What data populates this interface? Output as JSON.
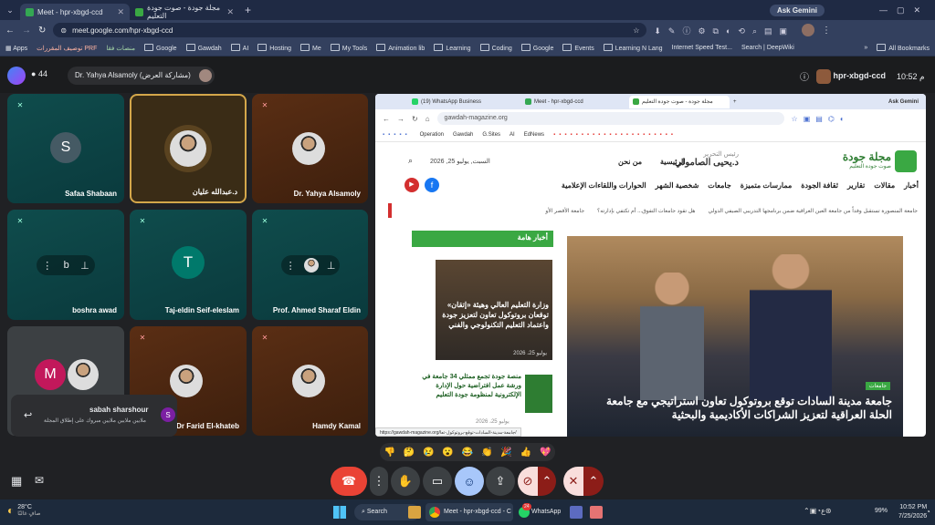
{
  "tabs": [
    {
      "title": "Meet - hpr-xbgd-ccd",
      "active": true
    },
    {
      "title": "مجلة جودة - صوت جودة التعليم",
      "active": false
    }
  ],
  "ask_gemini": "Ask Gemini",
  "url": "meet.google.com/hpr-xbgd-ccd",
  "bookmarks": [
    "Apps",
    "توصيف المقررات PRF",
    "منصات فقا",
    "Google",
    "Gawdah",
    "AI",
    "Hosting",
    "Me",
    "My Tools",
    "Animation lib",
    "Learning",
    "Coding",
    "Google",
    "Events",
    "Learning N Lang",
    "Internet Speed Test...",
    "Search | DeepWiki"
  ],
  "all_bookmarks": "All Bookmarks",
  "meet": {
    "participant_count": "44",
    "presenter_chip": "Dr. Yahya Alsamoly (مشاركة العرض)",
    "time": "10:52 م",
    "meeting_code": "hpr-xbgd-ccd"
  },
  "tiles": [
    {
      "name": "Safaa Shabaan",
      "initial": "S",
      "color": "#455a64"
    },
    {
      "name": "د.عبدالله عليان",
      "initial": "",
      "color": ""
    },
    {
      "name": "Dr. Yahya Alsamoly",
      "initial": "",
      "color": ""
    },
    {
      "name": "boshra awad",
      "initial": "b",
      "color": ""
    },
    {
      "name": "Taj-eldin Seif-eleslam",
      "initial": "T",
      "color": "#00796b"
    },
    {
      "name": "Prof. Ahmed Sharaf Eldin",
      "initial": "",
      "color": ""
    },
    {
      "name": "",
      "initial": "M",
      "color": "#c2185b"
    },
    {
      "name": "Dr Farid El-khateb",
      "initial": "",
      "color": ""
    },
    {
      "name": "Hamdy Kamal",
      "initial": "",
      "color": ""
    }
  ],
  "toast": {
    "name": "sabah sharshour",
    "initial": "S",
    "message": "ملايين ملايين ملايين مبروك على إطلاق المجلة"
  },
  "emojis": [
    "👎",
    "🤔",
    "😢",
    "😮",
    "😂",
    "👏",
    "🎉",
    "👍",
    "💖"
  ],
  "site": {
    "tabs": [
      "(19) WhatsApp Business",
      "Meet - hpr-xbgd-ccd",
      "مجلة جودة - صوت جودة التعليم"
    ],
    "ask_gemini": "Ask Gemini",
    "url": "gawdah-magazine.org",
    "bookmarks": [
      "Operation",
      "Gawdah",
      "G.Sites",
      "AI",
      "EdNews"
    ],
    "logo_title": "مجلة جودة",
    "logo_sub": "صوت جودة التعليم",
    "editor_label": "رئيس التحرير",
    "editor_name": "د.يحيى الصامولي",
    "date": "السبت, يوليو 25, 2026",
    "nav_top": [
      "الرئيسية",
      "من نحن"
    ],
    "nav": [
      "أخبار",
      "مقالات",
      "تقارير",
      "ثقافة الجودة",
      "ممارسات متميزة",
      "جامعات",
      "شخصية الشهر",
      "الحوارات واللقاءات الإعلامية"
    ],
    "ticker": [
      "جامعة المنصورة تستقبل وفداً من جامعة العين العراقية ضمن برنامجها التدريبي الصيفي الدولي",
      "هل تقود جامعات التفوق... أم تكتفي بإدارته؟",
      "جامعة الأقصر الأو"
    ],
    "side_header": "أخبار هامة",
    "side_story1": "وزارة التعليم العالي وهيئة «إتقان» توقعان بروتوكول تعاون لتعزيز جودة واعتماد التعليم التكنولوجي والفني",
    "side_date1": "يوليو 25، 2026",
    "side_story2": "منصة جودة تجمع ممثلي 34 جامعة في ورشة عمل افتراضية حول الإدارة الإلكترونية لمنظومة جودة التعليم",
    "side_date2": "يوليو 25، 2026",
    "hero_badge": "جامعات",
    "hero_title": "جامعة مدينة السادات توقع بروتوكول تعاون استراتيجي مع جامعة الحلة العراقية لتعزيز الشراكات الأكاديمية والبحثية",
    "status_url": "https://gawdah-magazine.org/جامعة-مدينة-السادات-توقع-بروتوكول-تعا/"
  },
  "taskbar": {
    "weather_temp": "28°C",
    "weather_text": "صافٍ غالبًا",
    "search": "Search",
    "app_meet": "Meet - hpr-xbgd-ccd - C",
    "app_whatsapp": "WhatsApp",
    "whatsapp_badge": "24",
    "lang": "ع",
    "battery": "99%",
    "time": "10:52 PM",
    "date": "7/25/2026"
  },
  "colors": {
    "accent_green": "#3aa843",
    "end_call": "#ea4335"
  }
}
